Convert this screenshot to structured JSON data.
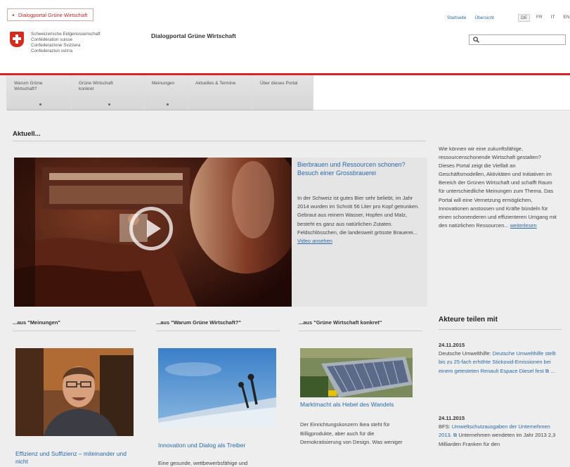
{
  "header": {
    "breadcrumb": "Dialogportal Grüne Wirtschaft",
    "confederation": [
      "Schweizerische Eidgenossenschaft",
      "Confédération suisse",
      "Confederazione Svizzera",
      "Confederaziun svizra"
    ],
    "portal_title": "Dialogportal Grüne Wirtschaft",
    "service_links": [
      "Startseite",
      "Übersicht"
    ],
    "languages": [
      "DE",
      "FR",
      "IT",
      "EN"
    ],
    "active_language": "DE",
    "search": {
      "placeholder": "",
      "value": ""
    }
  },
  "nav": [
    {
      "label": "Warum Grüne Wirtschaft?"
    },
    {
      "label": "Grüne Wirtschaft konkret"
    },
    {
      "label": "Meinungen"
    },
    {
      "label": "Aktuelles & Termine"
    },
    {
      "label": "Über dieses Portal"
    }
  ],
  "main": {
    "heading": "Aktuell...",
    "feature": {
      "title": "Bierbrauen und Ressourcen schonen? Besuch einer Grossbrauerei",
      "text": "In der Schweiz ist gutes Bier sehr beliebt, im Jahr 2014 wurden im Schnitt 56 Liter pro Kopf getrunken. Gebraut aus reinem Wasser, Hopfen und Malz, besteht es ganz aus natürlichen Zutaten. Feldschlösschen, die landesweit grösste Brauerei...",
      "link": "Video ansehen"
    },
    "columns": [
      {
        "heading": "...aus \"Meinungen\"",
        "title": "Effizienz und Suffizienz – miteinander und nicht",
        "text": ""
      },
      {
        "heading": "...aus \"Warum Grüne Wirtschaft?\"",
        "title": "Innovation und Dialog als Treiber",
        "text": "Eine gesunde, wettbewerbsfähige und"
      },
      {
        "heading": "...aus \"Grüne Wirtschaft konkret\"",
        "title": "Marktmacht als Hebel des Wandels",
        "text": "Der Einrichtungskonzern Ikea steht für Billigprodukte, aber auch für die Demokratisierung von Design. Was weniger"
      }
    ]
  },
  "sidebar": {
    "intro": "Wie können wir eine zukunftsfähige, ressourcenschonende Wirtschaft gestalten? Dieses Portal zeigt die Vielfalt an Geschäftsmodellen, Aktivitäten und Initiativen im Bereich der Grünen Wirtschaft und schafft Raum für unterschiedliche Meinungen zum Thema. Das Portal will eine Vernetzung ermöglichen, Innovationen anstossen und Kräfte bündeln für einen schonenderen und effizienteren Umgang mit den natürlichen Ressourcen...",
    "intro_link": "weiterlesen",
    "share_heading": "Akteure teilen mit",
    "news": [
      {
        "date": "24.11.2015",
        "source": "Deutsche Umwelthilfe:",
        "link": "Deutsche Umwelthilfe stellt bis zu 25-fach erhöhte Stickoxid-Emissionen bei einem getesteten Renault Espace Diesel fest",
        "after": "..."
      },
      {
        "date": "24.11.2015",
        "source": "BFS:",
        "link": "Umweltschutzausgaben der Unternehmen 2013.",
        "after": "Unternehmen wendeten im Jahr 2013 2,3 Milliarden Franken für den"
      }
    ]
  }
}
